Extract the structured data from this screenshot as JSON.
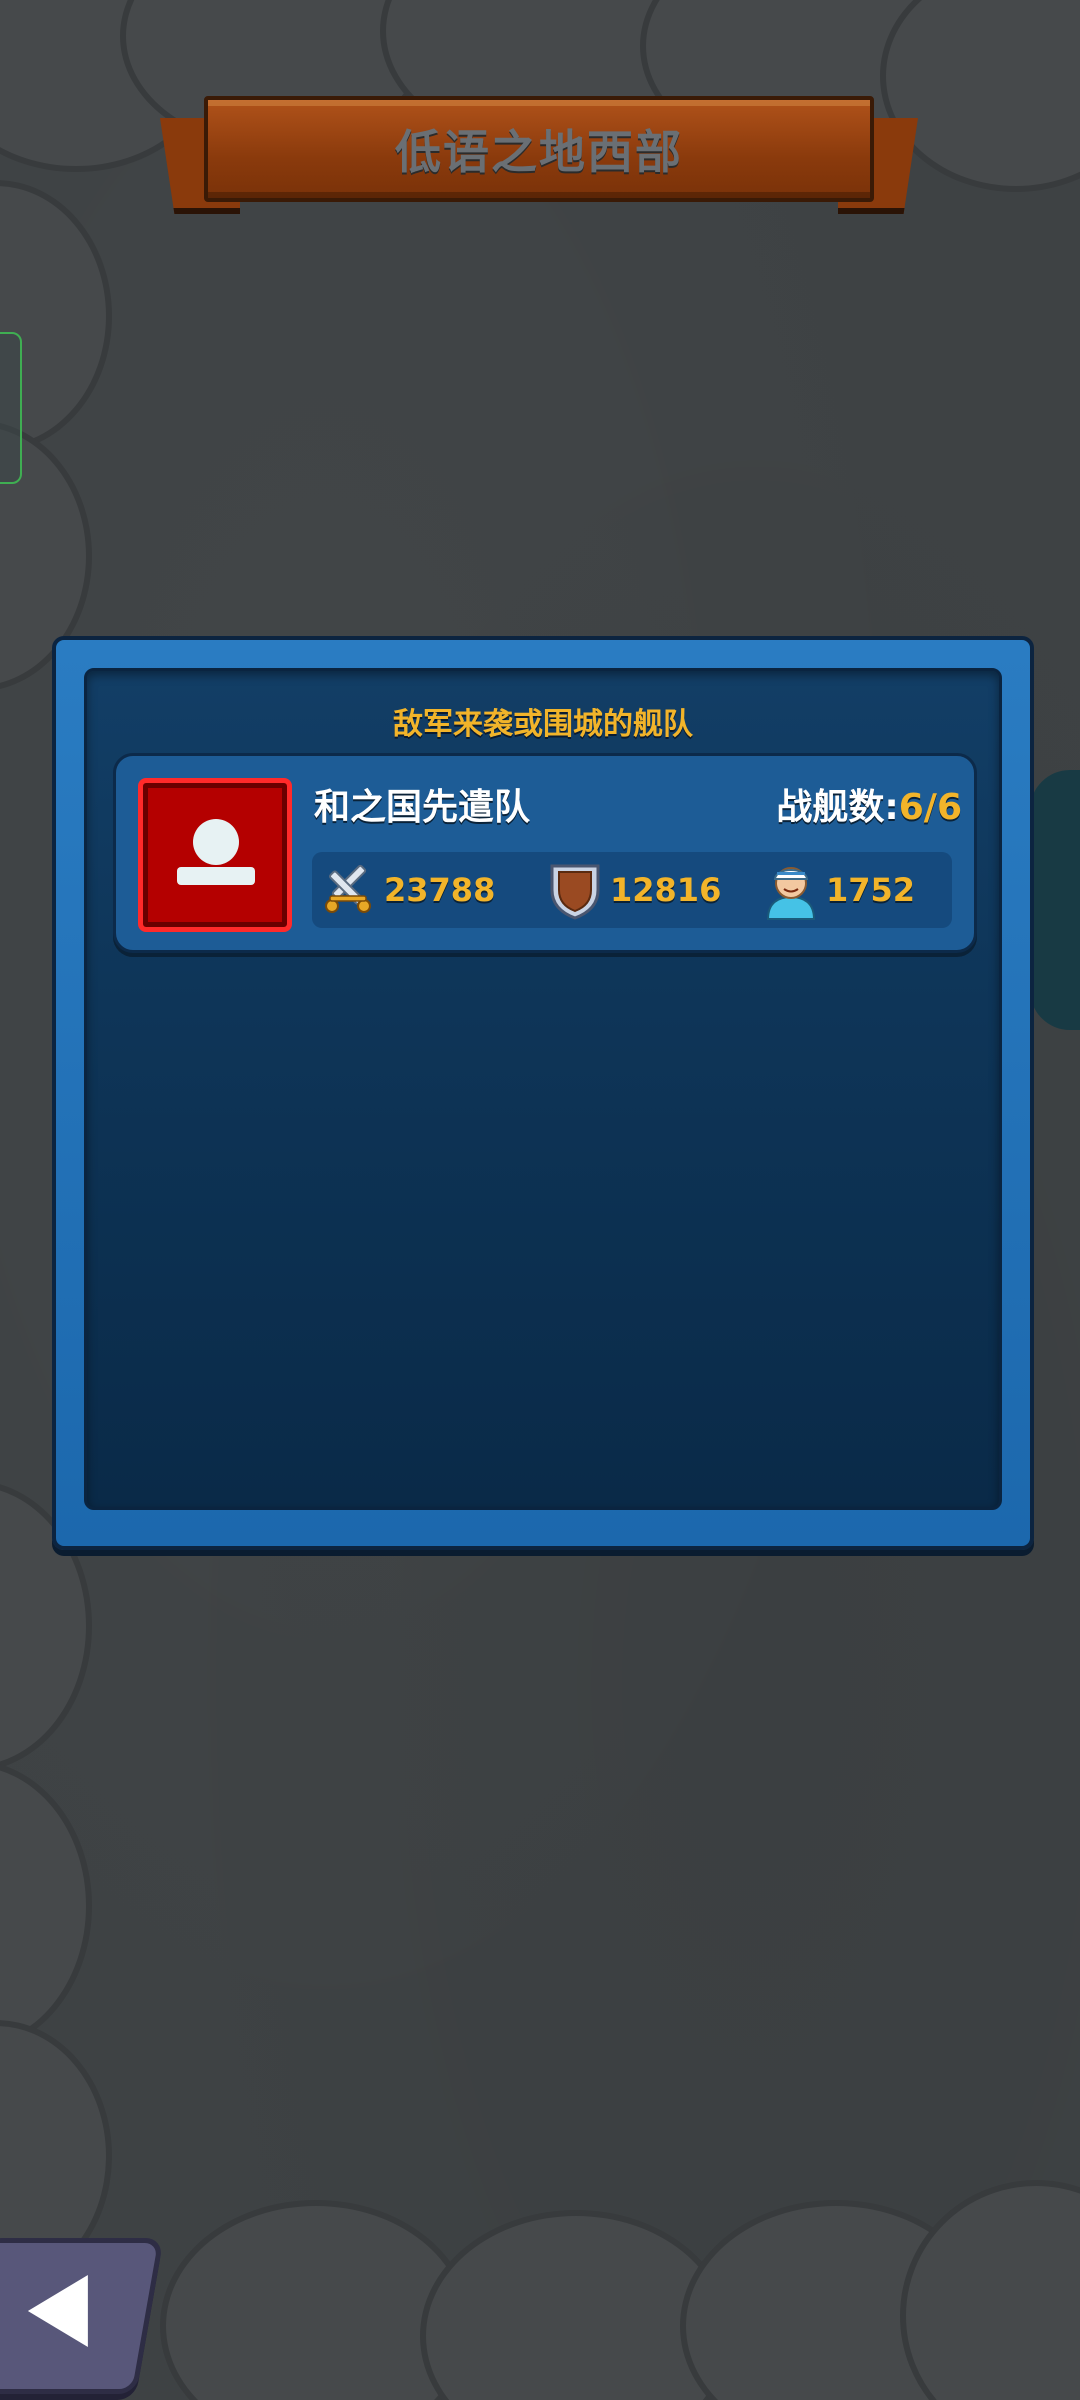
{
  "header": {
    "title": "低语之地西部"
  },
  "panel": {
    "heading": "敌军来袭或围城的舰队",
    "fleets": [
      {
        "name": "和之国先遣队",
        "ship_count_label": "战舰数:",
        "ship_count_value": "6/6",
        "attack": "23788",
        "defense": "12816",
        "crew": "1752",
        "avatar_icon": "user-silhouette-icon"
      }
    ]
  },
  "colors": {
    "accent_gold": "#f2b42a",
    "panel_blue": "#1c68ad",
    "avatar_red": "#b40000",
    "banner_brown": "#8a3a0c"
  },
  "icons": {
    "attack": "crossed-swords-icon",
    "defense": "shield-icon",
    "crew": "sailor-icon",
    "back": "back-arrow-icon"
  }
}
